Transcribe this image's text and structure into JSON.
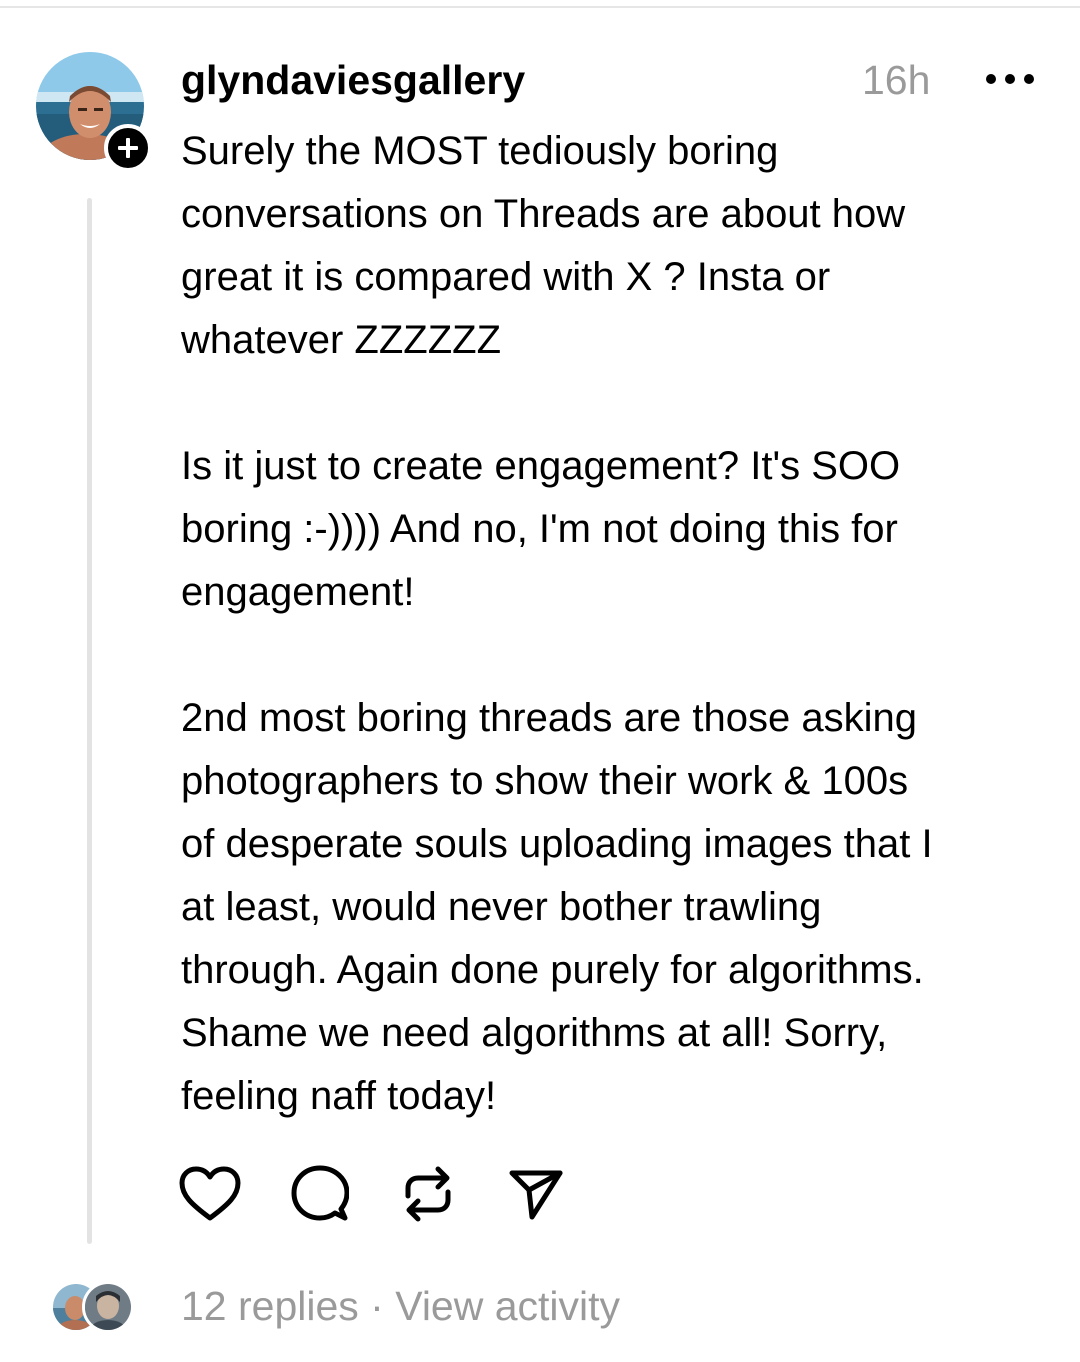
{
  "post": {
    "username": "glyndaviesgallery",
    "timestamp": "16h",
    "avatar_icon": "profile-photo",
    "follow_icon": "plus-icon",
    "more_icon": "more-horizontal-icon",
    "body": {
      "para1": [
        "Surely the MOST tediously boring",
        "conversations on Threads are about how",
        "great it is compared with X ? Insta or",
        "whatever ZZZZZZ"
      ],
      "para2": [
        "Is it just to create engagement? It's SOO",
        "boring :-)))) And no, I'm not doing this for",
        "engagement!"
      ],
      "para3": [
        "2nd most boring threads are those asking",
        "photographers to show their work & 100s",
        "of desperate souls uploading images that I",
        "at least, would never bother trawling",
        "through. Again done purely for algorithms.",
        "Shame we need algorithms at all! Sorry,",
        "feeling naff today!"
      ]
    }
  },
  "actions": {
    "like_icon": "heart-icon",
    "comment_icon": "comment-icon",
    "repost_icon": "repost-icon",
    "share_icon": "send-icon"
  },
  "footer": {
    "replies": "12 replies",
    "separator": " · ",
    "view_activity": "View activity"
  },
  "colors": {
    "text": "#000000",
    "muted": "#9a9a9a",
    "thread_line": "#e3e3e3",
    "background": "#ffffff"
  }
}
